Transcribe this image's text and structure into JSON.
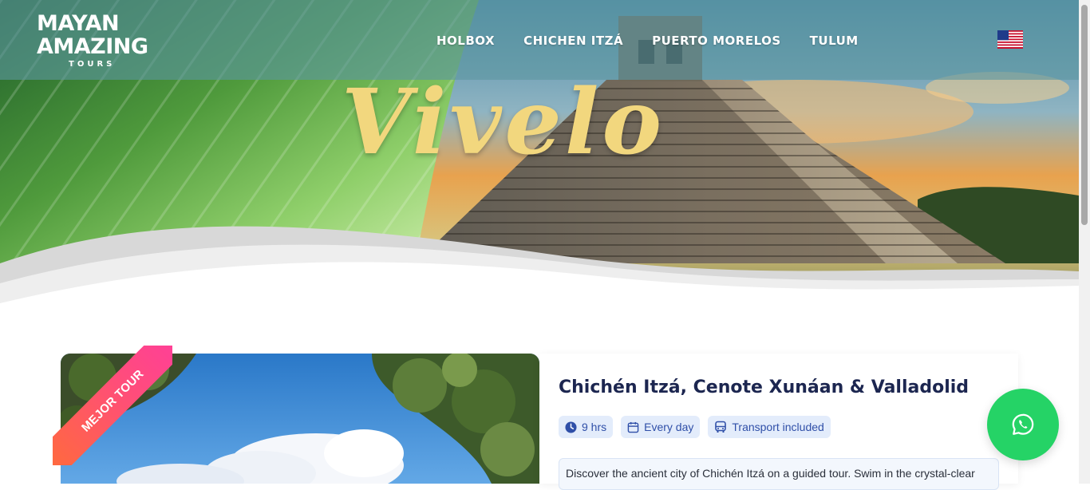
{
  "logo": {
    "line1": "MAYAN",
    "line2": "AMAZING",
    "line3": "TOURS"
  },
  "nav": {
    "items": [
      {
        "label": "HOLBOX"
      },
      {
        "label": "CHICHEN ITZÁ"
      },
      {
        "label": "PUERTO MORELOS"
      },
      {
        "label": "TULUM"
      }
    ]
  },
  "language": {
    "icon": "us-flag-icon"
  },
  "hero": {
    "headline": "Vivelo"
  },
  "tour": {
    "ribbon": "MEJOR TOUR",
    "title": "Chichén Itzá, Cenote Xunáan & Valladolid",
    "badges": [
      {
        "icon": "clock-icon",
        "label": "9 hrs"
      },
      {
        "icon": "calendar-icon",
        "label": "Every day"
      },
      {
        "icon": "bus-icon",
        "label": "Transport included"
      }
    ],
    "description": "Discover the ancient city of Chichén Itzá on a guided tour. Swim in the crystal-clear"
  },
  "whatsapp": {
    "icon": "whatsapp-icon"
  },
  "colors": {
    "accent": "#2f4fa8",
    "title": "#1c2650",
    "headline": "#f2d77e",
    "whatsapp": "#25d366",
    "badge_bg": "#e3ecfb"
  }
}
